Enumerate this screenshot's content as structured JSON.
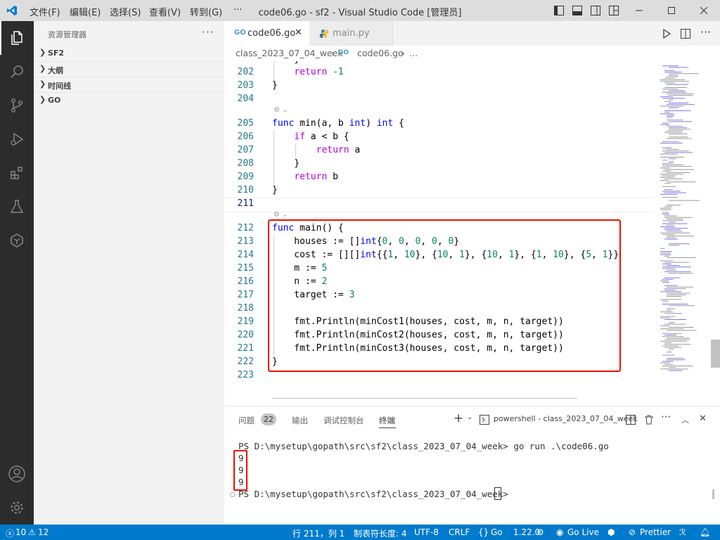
{
  "menu": [
    "文件(F)",
    "编辑(E)",
    "选择(S)",
    "查看(V)",
    "转到(G)",
    "···"
  ],
  "window_title": "code06.go - sf2 - Visual Studio Code [管理员]",
  "sidebar": {
    "title": "资源管理器",
    "sections": [
      "SF2",
      "大纲",
      "时间线",
      "GO"
    ]
  },
  "tabs": [
    {
      "label": "code06.go",
      "active": true
    },
    {
      "label": "main.py",
      "active": false
    }
  ],
  "breadcrumb": {
    "folder": "class_2023_07_04_week",
    "file": "code06.go",
    "more": "..."
  },
  "editor": {
    "partial_line": "    }",
    "lines": [
      {
        "n": "202",
        "text": "    return -1"
      },
      {
        "n": "203",
        "text": "}"
      },
      {
        "n": "204",
        "text": ""
      },
      {
        "n": "205",
        "text": "func min(a, b int) int {"
      },
      {
        "n": "206",
        "text": "    if a < b {"
      },
      {
        "n": "207",
        "text": "        return a"
      },
      {
        "n": "208",
        "text": "    }"
      },
      {
        "n": "209",
        "text": "    return b"
      },
      {
        "n": "210",
        "text": "}"
      },
      {
        "n": "211",
        "text": ""
      },
      {
        "n": "212",
        "text": "func main() {"
      },
      {
        "n": "213",
        "text": "    houses := []int{0, 0, 0, 0, 0}"
      },
      {
        "n": "214",
        "text": "    cost := [][]int{{1, 10}, {10, 1}, {10, 1}, {1, 10}, {5, 1}}"
      },
      {
        "n": "215",
        "text": "    m := 5"
      },
      {
        "n": "216",
        "text": "    n := 2"
      },
      {
        "n": "217",
        "text": "    target := 3"
      },
      {
        "n": "218",
        "text": ""
      },
      {
        "n": "219",
        "text": "    fmt.Println(minCost1(houses, cost, m, n, target))"
      },
      {
        "n": "220",
        "text": "    fmt.Println(minCost2(houses, cost, m, n, target))"
      },
      {
        "n": "221",
        "text": "    fmt.Println(minCost3(houses, cost, m, n, target))"
      },
      {
        "n": "222",
        "text": "}"
      },
      {
        "n": "223",
        "text": ""
      }
    ]
  },
  "panel": {
    "tabs": [
      "问题",
      "输出",
      "调试控制台",
      "终端"
    ],
    "problems_count": "22",
    "active_tab": "终端",
    "terminal_name": "powershell - class_2023_07_04_week",
    "terminal_lines": [
      "PS D:\\mysetup\\gopath\\src\\sf2\\class_2023_07_04_week> go run .\\code06.go",
      "9",
      "9",
      "9",
      "PS D:\\mysetup\\gopath\\src\\sf2\\class_2023_07_04_week> "
    ]
  },
  "status": {
    "errors": "10",
    "warnings": "12",
    "position": "行 211，列 1",
    "tab_size": "制表符长度: 4",
    "encoding": "UTF-8",
    "eol": "CRLF",
    "language": "Go",
    "go_version": "1.22.0",
    "go_live": "Go Live",
    "prettier": "Prettier"
  },
  "colors": {
    "accent": "#007acc",
    "highlight_box": "#e51400",
    "activity_bar": "#2c2c2c"
  }
}
